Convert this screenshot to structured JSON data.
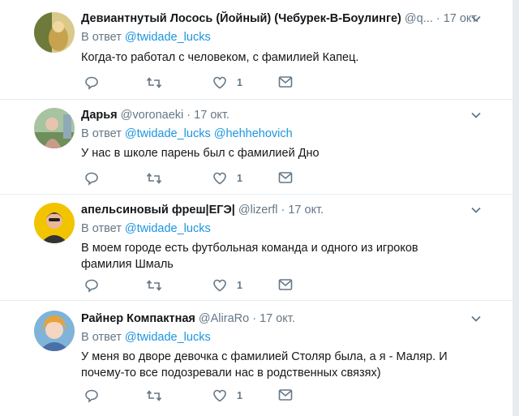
{
  "tweets": [
    {
      "name": "Девиантнутый Лосось (Йойный) (Чебурек-В-Боулинге)",
      "handle": "@q...",
      "time": "17 окт.",
      "reply_prefix": "В ответ",
      "mentions": [
        "@twidade_lucks"
      ],
      "text": "Когда-то работал с человеком, с фамилией Капец.",
      "like_count": "1",
      "avatar_colors": {
        "bg": "#d9c98a",
        "fg": "#8a7a3a"
      }
    },
    {
      "name": "Дарья",
      "handle": "@voronaeki",
      "time": "17 окт.",
      "reply_prefix": "В ответ",
      "mentions": [
        "@twidade_lucks",
        "@hehhehovich"
      ],
      "text": "У нас в школе парень был с фамилией Дно",
      "like_count": "1",
      "avatar_colors": {
        "bg": "#a7c4a0",
        "fg": "#c89b8a"
      }
    },
    {
      "name": "апельсиновый фреш|ЕГЭ|",
      "handle": "@lizerfl",
      "time": "17 окт.",
      "reply_prefix": "В ответ",
      "mentions": [
        "@twidade_lucks"
      ],
      "text": "В моем городе есть футбольная команда и одного из игроков фамилия Шмаль",
      "like_count": "1",
      "avatar_colors": {
        "bg": "#f2c400",
        "fg": "#333333"
      }
    },
    {
      "name": "Райнер Компактная",
      "handle": "@AliraRo",
      "time": "17 окт.",
      "reply_prefix": "В ответ",
      "mentions": [
        "@twidade_lucks"
      ],
      "text": "У меня во дворе девочка с фамилией Столяр была, а я - Маляр. И почему-то все подозревали нас в родственных связях)",
      "like_count": "1",
      "avatar_colors": {
        "bg": "#7fb4d8",
        "fg": "#e8a23a"
      }
    }
  ],
  "separator": "·",
  "icons": [
    "reply-icon",
    "retweet-icon",
    "like-icon",
    "dm-icon",
    "chevron-down-icon"
  ],
  "colors": {
    "link": "#1b95e0",
    "muted": "#657786",
    "text": "#14171a",
    "border": "#e6ecf0"
  }
}
